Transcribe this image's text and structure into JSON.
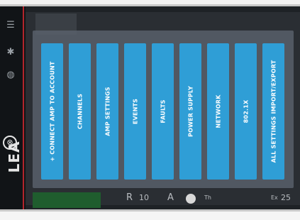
{
  "menu": {
    "buttons": [
      {
        "label": "+ CONNECT AMP TO ACCOUNT"
      },
      {
        "label": "CHANNELS"
      },
      {
        "label": "AMP SETTINGS"
      },
      {
        "label": "EVENTS"
      },
      {
        "label": "FAULTS"
      },
      {
        "label": "POWER SUPPLY"
      },
      {
        "label": "NETWORK"
      },
      {
        "label": "802.1X"
      },
      {
        "label": "ALL SETTINGS IMPORT/EXPORT"
      }
    ]
  },
  "brand": {
    "name": "LEA",
    "mark": "⊗"
  },
  "sidebar": {
    "icons": [
      "menu-icon",
      "settings-icon",
      "globe-icon"
    ]
  },
  "background": {
    "row_texts": [
      "R",
      "10",
      "A",
      "Th",
      "Ex",
      "25"
    ]
  },
  "colors": {
    "button": "#2f9ed6",
    "overlay": "#5a626c",
    "accent_rule": "#b3252c"
  }
}
